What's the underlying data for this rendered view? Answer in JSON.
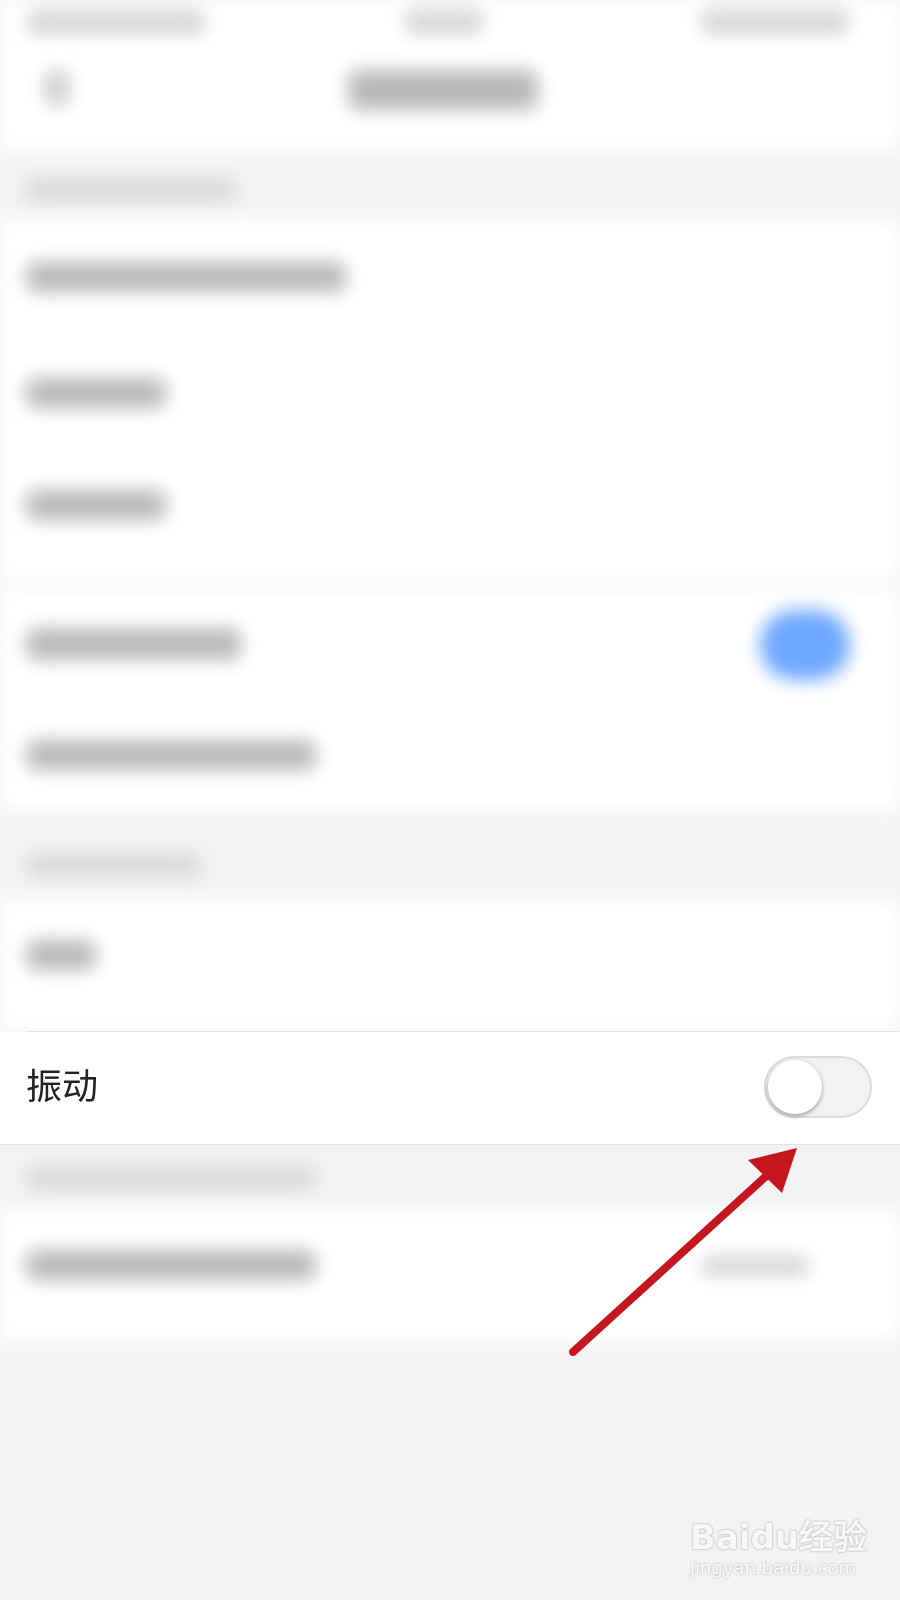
{
  "vibrate_row": {
    "label": "振动",
    "toggle_on": false
  },
  "watermark": {
    "brand": "Baidu经验",
    "url": "jingyan.baidu.com"
  },
  "colors": {
    "arrow": "#c4161c",
    "toggle_track": "#f2f2f2",
    "blurred_toggle": "#6ea8ff"
  }
}
